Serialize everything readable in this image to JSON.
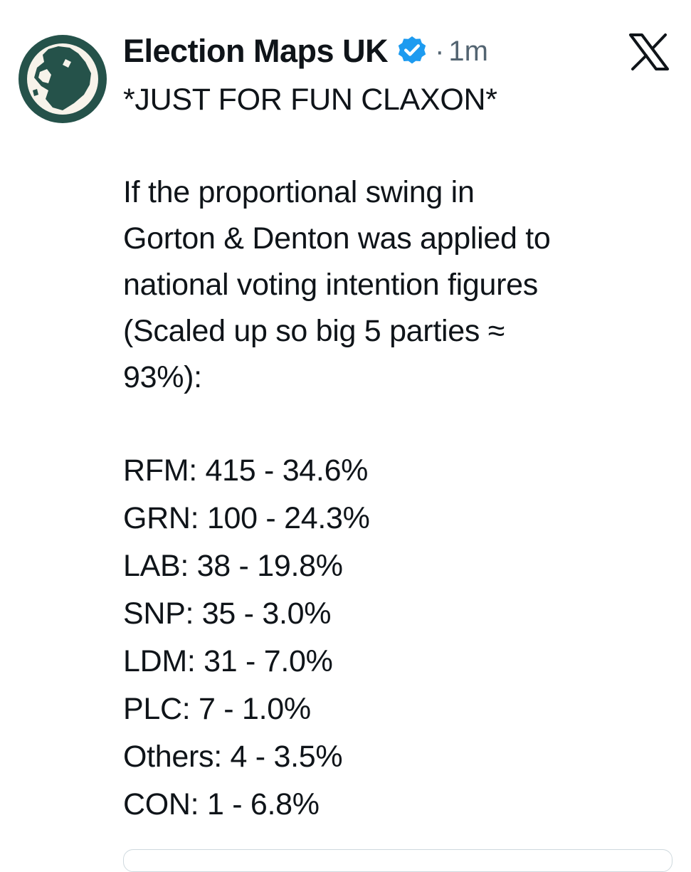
{
  "tweet": {
    "author": {
      "display_name": "Election Maps UK",
      "verified_icon": "verified-badge-icon",
      "avatar_icon": "uk-map-avatar-icon"
    },
    "separator": "·",
    "time": "1m",
    "platform_icon": "x-logo-icon",
    "colors": {
      "avatar_ring": "#25524a",
      "verified": "#1d9bf0",
      "muted_text": "#536471"
    },
    "text": {
      "line1": "*JUST FOR FUN CLAXON*",
      "line2": "If the proportional swing in",
      "line3": "Gorton & Denton was applied to",
      "line4": "national voting intention figures",
      "line5": "(Scaled up so big 5 parties ≈",
      "line6": "93%):",
      "results": [
        "RFM: 415 - 34.6%",
        "GRN: 100 - 24.3%",
        "LAB: 38 - 19.8%",
        "SNP: 35 - 3.0%",
        "LDM: 31 - 7.0%",
        "PLC: 7 - 1.0%",
        "Others: 4 - 3.5%",
        "CON: 1 - 6.8%"
      ]
    }
  }
}
